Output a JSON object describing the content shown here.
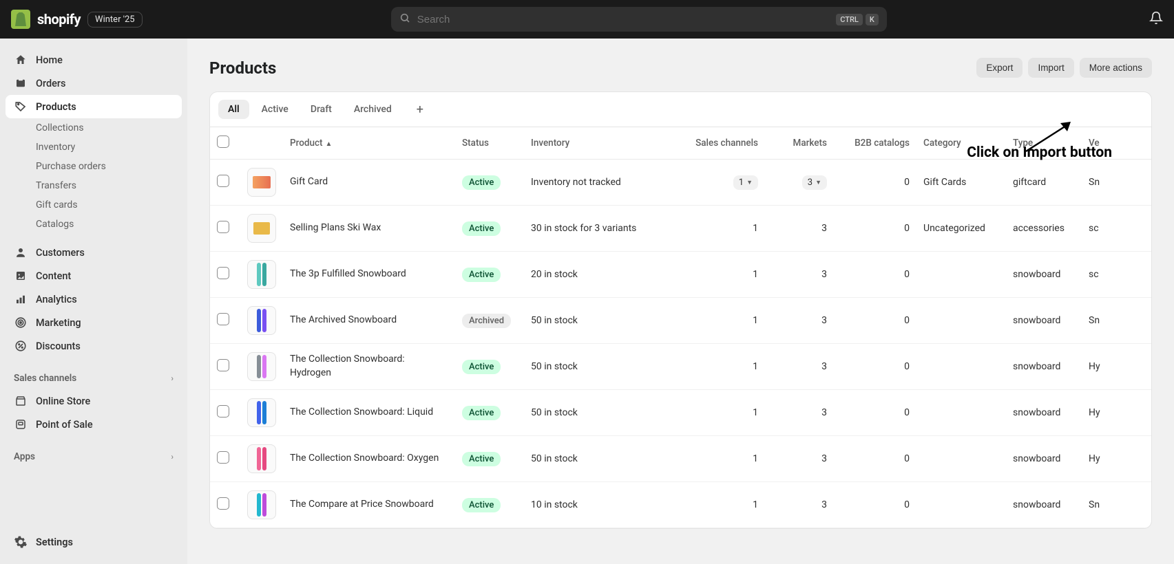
{
  "header": {
    "brand": "shopify",
    "edition": "Winter '25",
    "search_placeholder": "Search",
    "kbd1": "CTRL",
    "kbd2": "K"
  },
  "annotation": "Click on Import button",
  "sidebar": {
    "items": [
      {
        "label": "Home",
        "icon": "home"
      },
      {
        "label": "Orders",
        "icon": "orders"
      },
      {
        "label": "Products",
        "icon": "products",
        "active": true
      },
      {
        "label": "Customers",
        "icon": "customers"
      },
      {
        "label": "Content",
        "icon": "content"
      },
      {
        "label": "Analytics",
        "icon": "analytics"
      },
      {
        "label": "Marketing",
        "icon": "marketing"
      },
      {
        "label": "Discounts",
        "icon": "discounts"
      }
    ],
    "products_sub": [
      "Collections",
      "Inventory",
      "Purchase orders",
      "Transfers",
      "Gift cards",
      "Catalogs"
    ],
    "channels_header": "Sales channels",
    "channels": [
      {
        "label": "Online Store"
      },
      {
        "label": "Point of Sale"
      }
    ],
    "apps_header": "Apps",
    "settings": "Settings"
  },
  "page": {
    "title": "Products",
    "export_btn": "Export",
    "import_btn": "Import",
    "more_btn": "More actions"
  },
  "tabs": [
    "All",
    "Active",
    "Draft",
    "Archived"
  ],
  "columns": {
    "product": "Product",
    "status": "Status",
    "inventory": "Inventory",
    "sales_channels": "Sales channels",
    "markets": "Markets",
    "b2b": "B2B catalogs",
    "category": "Category",
    "type": "Type",
    "vendor": "Ve"
  },
  "rows": [
    {
      "name": "Gift Card",
      "status": "Active",
      "inventory": "Inventory not tracked",
      "sales": "1",
      "sales_drop": true,
      "markets": "3",
      "markets_drop": true,
      "b2b": "0",
      "category": "Gift Cards",
      "type": "giftcard",
      "vendor": "Sn",
      "thumb": "giftcard"
    },
    {
      "name": "Selling Plans Ski Wax",
      "status": "Active",
      "inventory": "30 in stock for 3 variants",
      "sales": "1",
      "markets": "3",
      "b2b": "0",
      "category": "Uncategorized",
      "type": "accessories",
      "vendor": "sc",
      "thumb": "wax"
    },
    {
      "name": "The 3p Fulfilled Snowboard",
      "status": "Active",
      "inventory": "20 in stock",
      "sales": "1",
      "markets": "3",
      "b2b": "0",
      "category": "",
      "type": "snowboard",
      "vendor": "sc",
      "thumb": "teal"
    },
    {
      "name": "The Archived Snowboard",
      "status": "Archived",
      "inventory": "50 in stock",
      "sales": "1",
      "markets": "3",
      "b2b": "0",
      "category": "",
      "type": "snowboard",
      "vendor": "Sn",
      "thumb": "purple"
    },
    {
      "name": "The Collection Snowboard: Hydrogen",
      "status": "Active",
      "inventory": "50 in stock",
      "sales": "1",
      "markets": "3",
      "b2b": "0",
      "category": "",
      "type": "snowboard",
      "vendor": "Hy",
      "thumb": "hydrogen"
    },
    {
      "name": "The Collection Snowboard: Liquid",
      "status": "Active",
      "inventory": "50 in stock",
      "sales": "1",
      "markets": "3",
      "b2b": "0",
      "category": "",
      "type": "snowboard",
      "vendor": "Hy",
      "thumb": "liquid"
    },
    {
      "name": "The Collection Snowboard: Oxygen",
      "status": "Active",
      "inventory": "50 in stock",
      "sales": "1",
      "markets": "3",
      "b2b": "0",
      "category": "",
      "type": "snowboard",
      "vendor": "Hy",
      "thumb": "oxygen"
    },
    {
      "name": "The Compare at Price Snowboard",
      "status": "Active",
      "inventory": "10 in stock",
      "sales": "1",
      "markets": "3",
      "b2b": "0",
      "category": "",
      "type": "snowboard",
      "vendor": "Sn",
      "thumb": "compare"
    }
  ]
}
